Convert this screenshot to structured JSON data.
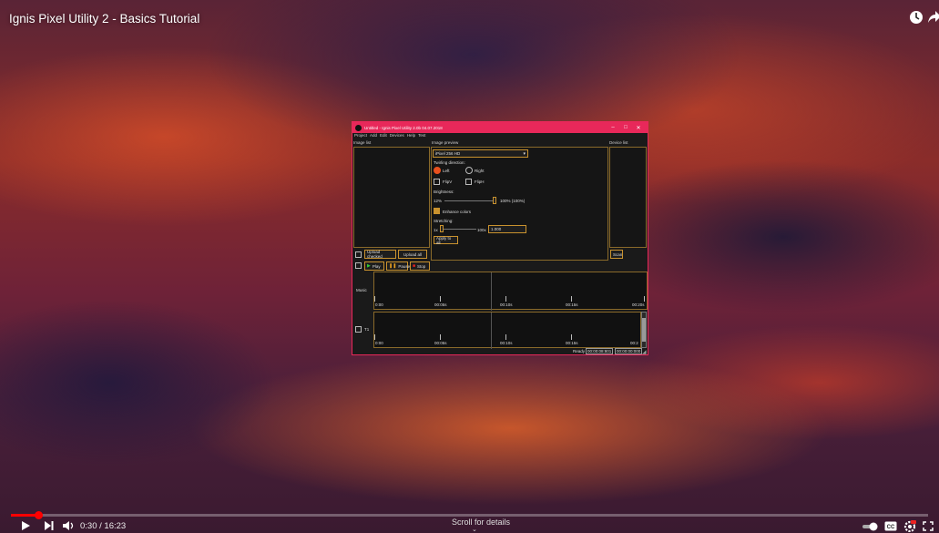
{
  "video": {
    "title": "Ignis Pixel Utility 2 - Basics Tutorial",
    "time": "0:30 / 16:23",
    "progress_fraction": 0.03,
    "scroll_hint": "Scroll for details",
    "icons": [
      "clock-icon",
      "share-icon",
      "play-icon",
      "next-icon",
      "volume-icon",
      "autoplay-toggle-icon",
      "cc-icon",
      "settings-icon",
      "fullscreen-icon"
    ]
  },
  "app": {
    "window_title": "Untitled - Ignis Pixel Utility 2.0b 04.07.2018",
    "menu": [
      "Project",
      "Add",
      "Edit",
      "Devices",
      "Help",
      "Test"
    ],
    "panes": {
      "image_list": "Image list",
      "image_preview": "Image preview",
      "device_list": "Device list"
    },
    "device_select": "iPixel 256 HD",
    "twirling_label": "Twirling direction:",
    "left": "Left",
    "right": "Right",
    "flip_v": "FlipV",
    "flip_h": "FlipH",
    "brightness_label": "Brightness:",
    "brightness_min": "12%",
    "brightness_value": "100% (100%)",
    "enhance_colors": "Enhance colors",
    "stretching_label": "Stretching:",
    "stretch_min": "1x",
    "stretch_max": "100x",
    "stretch_value": "1.000",
    "apply_all": "Apply to all",
    "upload_checked": "Upload checked",
    "upload_all": "Upload all",
    "scan": "Scan",
    "play": "Play",
    "pause": "Pause",
    "stop": "Stop",
    "music_label": "Music",
    "track1_label": "T1",
    "timeline_ticks": [
      "0:00",
      "00:05s",
      "00:10s",
      "00:15s",
      "00:20s"
    ],
    "timeline_ticks2": [
      "0:00",
      "00:05s",
      "00:10s",
      "00:15s",
      "00:2"
    ],
    "status": {
      "ready": "Ready",
      "pos": "00:00:08:801",
      "end": "00:00:00:000"
    },
    "colors": {
      "accent": "#e8285a",
      "border": "#c9922e",
      "orange": "#e8501e"
    }
  }
}
